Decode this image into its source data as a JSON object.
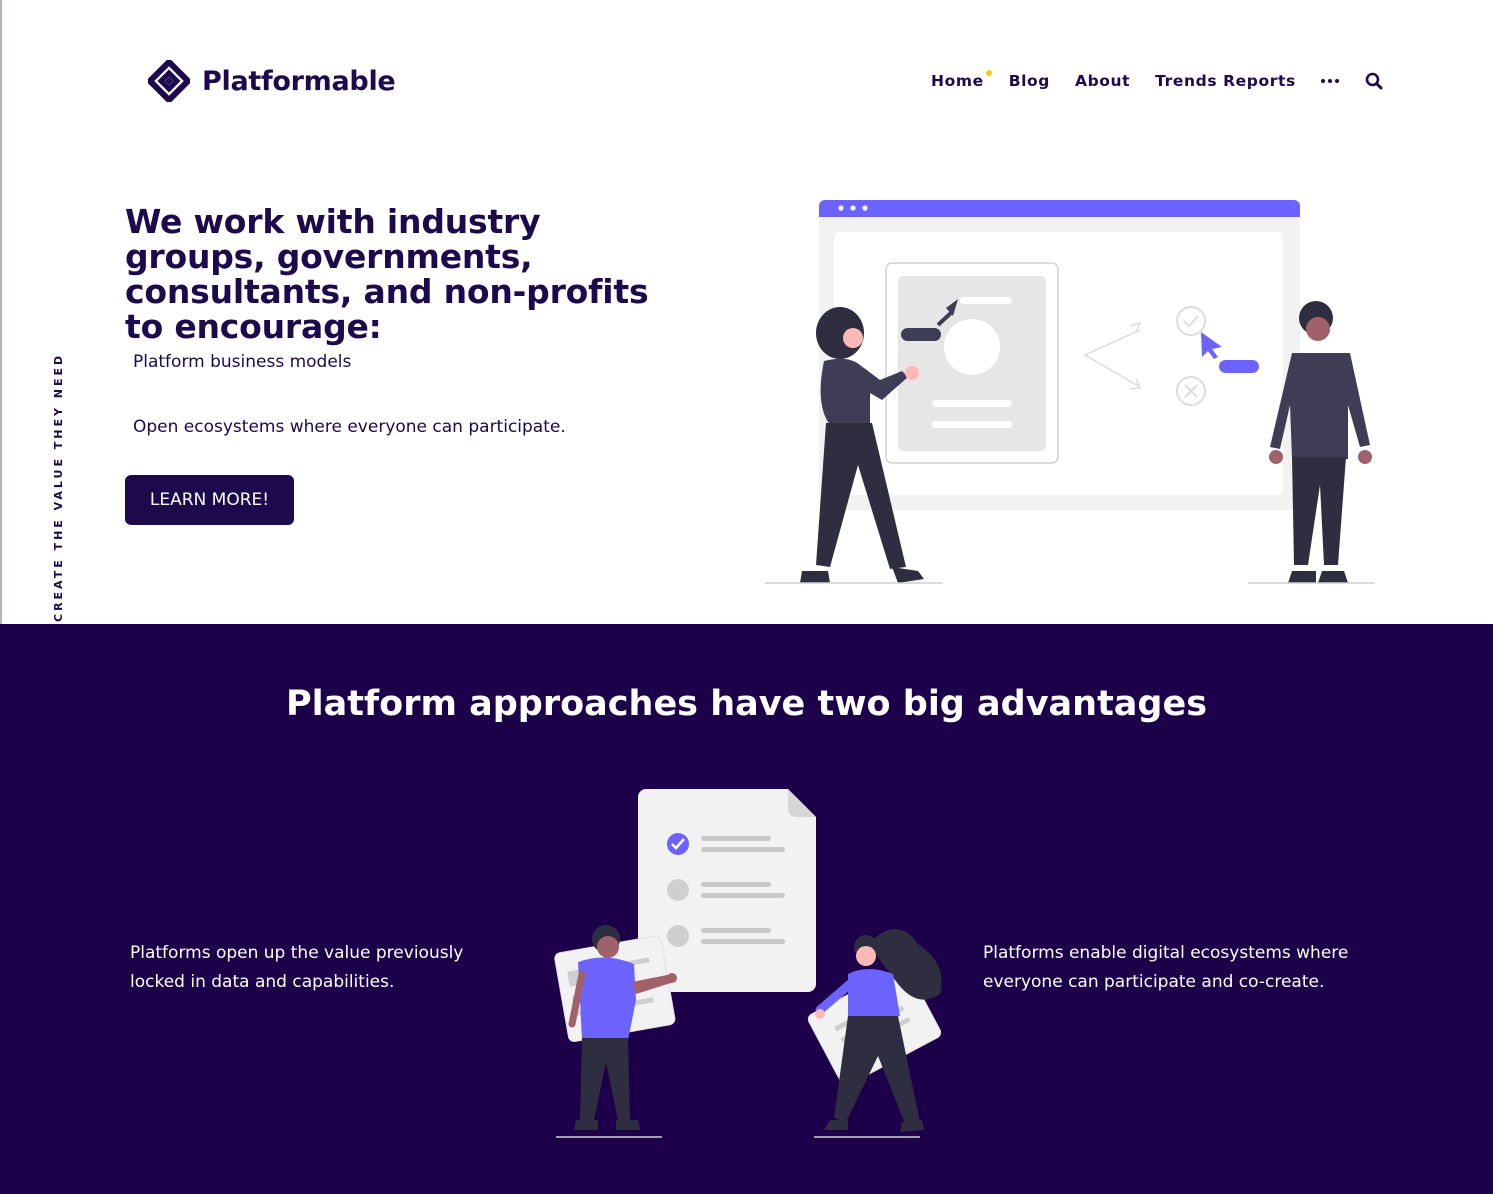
{
  "header": {
    "logo_text": "Platformable",
    "nav": [
      {
        "label": "Home",
        "active": true
      },
      {
        "label": "Blog"
      },
      {
        "label": "About"
      },
      {
        "label": "Trends Reports"
      }
    ],
    "more_icon": "ellipsis-icon",
    "search_icon": "search-icon"
  },
  "side_text": "CREATE THE VALUE THEY NEED",
  "hero": {
    "title": "We work with industry groups, governments, consultants, and non-profits to encourage:",
    "items": [
      "Platform business models",
      "Open ecosystems where everyone can participate."
    ],
    "cta": "LEARN MORE!"
  },
  "advantages": {
    "title": "Platform approaches have two big advantages",
    "left_text": "Platforms open up the value previously locked in data and capabilities.",
    "right_text": "Platforms enable digital ecosystems where everyone can participate and co-create."
  },
  "colors": {
    "brand_dark": "#1c0a4d",
    "section_bg": "#1c004a",
    "accent": "#6c63ff",
    "active_dot": "#f5c518"
  }
}
